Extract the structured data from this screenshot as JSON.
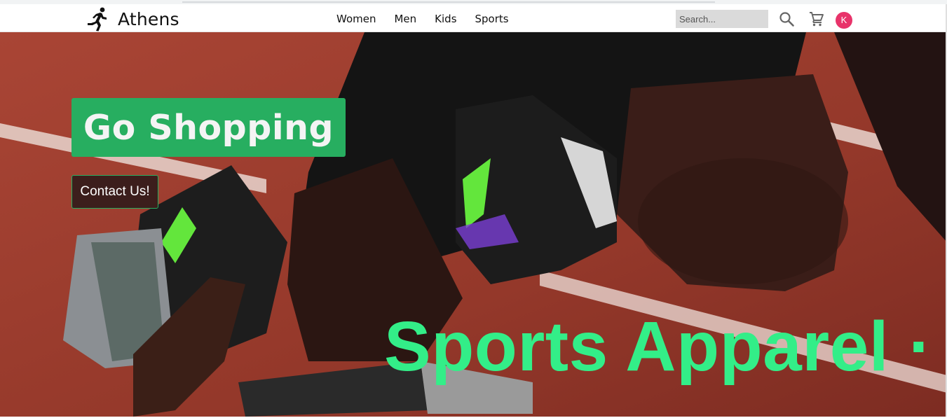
{
  "brand": {
    "name": "Athens",
    "logo_icon": "runner-icon"
  },
  "nav": {
    "items": [
      "Women",
      "Men",
      "Kids",
      "Sports"
    ]
  },
  "search": {
    "placeholder": "Search..."
  },
  "icons": {
    "search": "search-icon",
    "cart": "cart-icon"
  },
  "user": {
    "avatar_initial": "K"
  },
  "hero": {
    "headline": "Go Shopping",
    "cta_label": "Contact Us!",
    "marquee_text": "Sports Apparel ·"
  },
  "colors": {
    "headline_bg": "#27ae60",
    "marquee_text": "#33ee88",
    "avatar_bg": "#e8336a",
    "cta_bg": "#3c1e1c",
    "track": "#9a3a2c"
  }
}
